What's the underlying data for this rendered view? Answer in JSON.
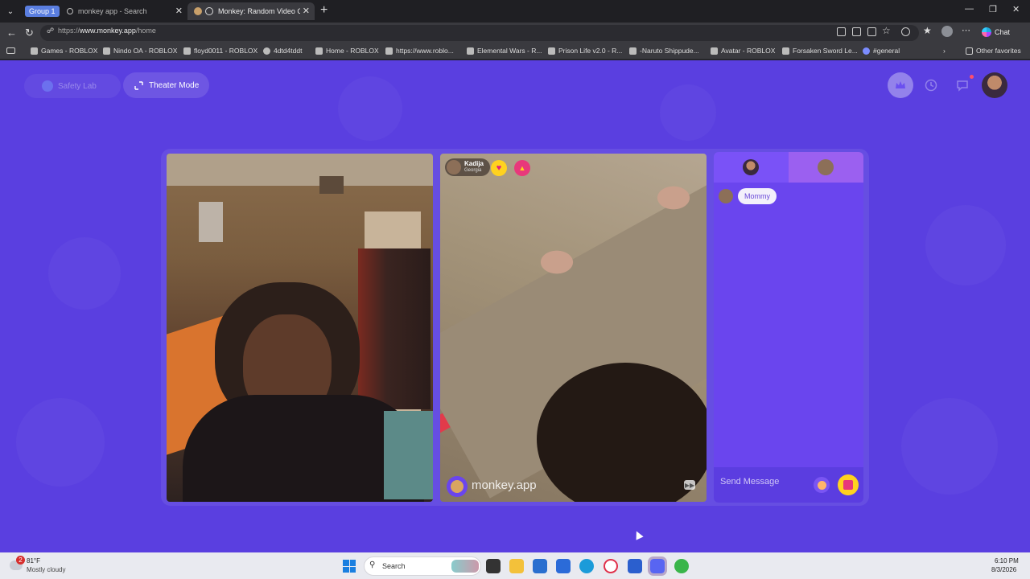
{
  "browser": {
    "tab_group_label": "Group 1",
    "tabs": [
      {
        "title": "monkey app - Search",
        "active": false
      },
      {
        "title": "Monkey: Random Video Chat",
        "active": true
      }
    ],
    "url_prefix": "https://",
    "url_host": "www.monkey.app",
    "url_path": "/home",
    "chat_label": "Chat",
    "bookmarks": [
      "Games - ROBLOX",
      "Nindo OA - ROBLOX",
      "floyd0011 - ROBLOX",
      "4dtd4tddt",
      "Home - ROBLOX",
      "https://www.roblo...",
      "Elemental Wars - R...",
      "Prison Life v2.0 - R...",
      "-Naruto Shippude...",
      "Avatar - ROBLOX",
      "Forsaken Sword Le...",
      "#general"
    ],
    "other_favorites": "Other favorites"
  },
  "page": {
    "safety_lab": "Safety Lab",
    "theater_mode": "Theater Mode",
    "peer": {
      "name": "Kadija",
      "location": "Georgia"
    },
    "watermark": "monkey.app",
    "chat": {
      "messages": [
        {
          "text": "Mommy"
        }
      ],
      "placeholder": "Send Message"
    },
    "accent_color": "#5a3fe0"
  },
  "taskbar": {
    "weather_temp": "81°F",
    "weather_desc": "Mostly cloudy",
    "weather_badge": "2",
    "search_label": "Search",
    "time": "6:10 PM",
    "date": "8/3/2026"
  }
}
